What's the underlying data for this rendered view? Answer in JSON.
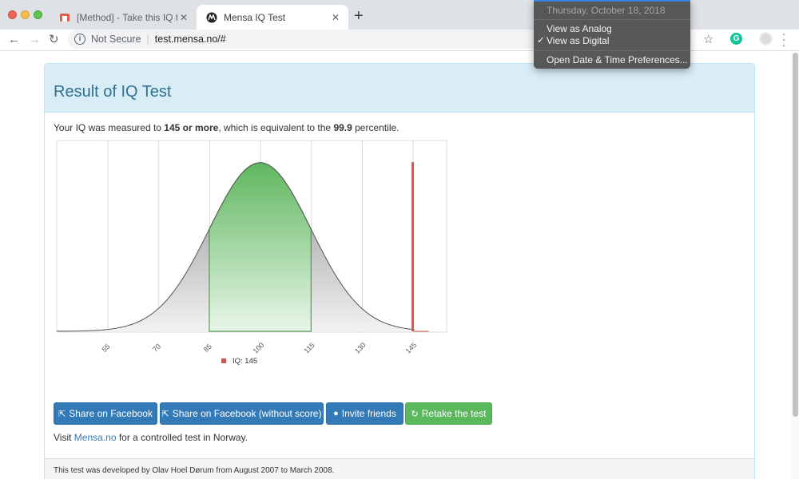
{
  "browser": {
    "tabs": [
      {
        "title": "[Method] - Take this IQ test an",
        "active": false
      },
      {
        "title": "Mensa IQ Test",
        "active": true
      }
    ],
    "security_label": "Not Secure",
    "url": "test.mensa.no/#",
    "extension_letter": "G",
    "new_tab_glyph": "+",
    "close_glyph": "✕"
  },
  "clock_menu": {
    "date": "Thursday, October 18, 2018",
    "items": [
      "View as Analog",
      "View as Digital",
      "Open Date & Time Preferences..."
    ],
    "checked_index": 1
  },
  "page": {
    "title": "Result of IQ Test",
    "result": {
      "prefix": "Your IQ was measured to ",
      "score": "145 or more",
      "middle": ", which is equivalent to the ",
      "percentile": "99.9",
      "suffix": " percentile."
    },
    "buttons": {
      "share_facebook": "Share on Facebook",
      "share_facebook_noscore": "Share on Facebook (without score)",
      "invite": "Invite friends",
      "retake": "Retake the test"
    },
    "visit": {
      "prefix": "Visit ",
      "link": "Mensa.no",
      "suffix": " for a controlled test in Norway."
    },
    "footer": "This test was developed by Olav Hoel Dørum from August 2007 to March 2008."
  },
  "chart_data": {
    "type": "area",
    "x_ticks": [
      55,
      70,
      85,
      100,
      115,
      130,
      145
    ],
    "xlim": [
      40,
      155
    ],
    "distribution": {
      "mean": 100,
      "sd": 15,
      "highlight_range": [
        85,
        115
      ]
    },
    "marker": {
      "value": 145,
      "label": "IQ: 145"
    },
    "legend": "IQ: 145",
    "colors": {
      "green": "#5cb85c",
      "gray": "#aaaaaa",
      "marker": "#d9534f"
    }
  }
}
